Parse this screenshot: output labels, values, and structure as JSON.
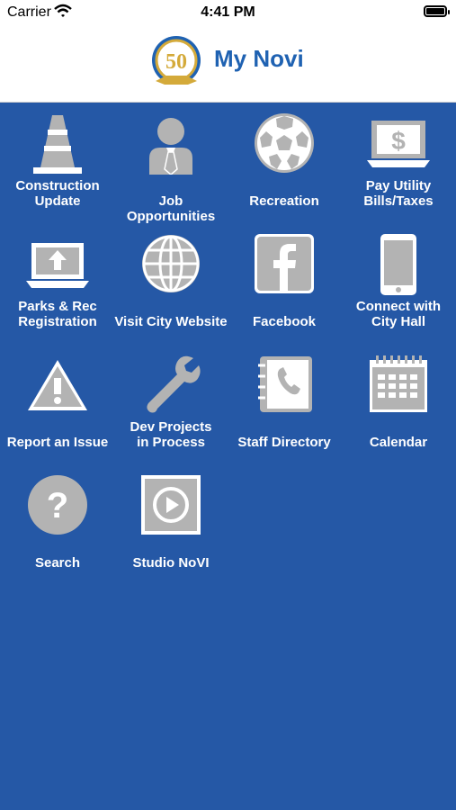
{
  "status_bar": {
    "carrier": "Carrier",
    "time": "4:41 PM",
    "battery_level": 1.0
  },
  "header": {
    "title": "My Novi",
    "logo_icon": "city-of-novi-50-logo-icon",
    "logo_number": "50"
  },
  "tiles": [
    {
      "label_line1": "Construction",
      "label_line2": "Update",
      "icon": "traffic-cone-icon"
    },
    {
      "label_line1": "Job Opportunities",
      "label_line2": "",
      "icon": "person-tie-icon"
    },
    {
      "label_line1": "Recreation",
      "label_line2": "",
      "icon": "soccer-ball-icon"
    },
    {
      "label_line1": "Pay Utility",
      "label_line2": "Bills/Taxes",
      "icon": "dollar-monitor-icon"
    },
    {
      "label_line1": "Parks & Rec",
      "label_line2": "Registration",
      "icon": "laptop-upload-icon"
    },
    {
      "label_line1": "Visit City Website",
      "label_line2": "",
      "icon": "globe-icon"
    },
    {
      "label_line1": "Facebook",
      "label_line2": "",
      "icon": "facebook-icon"
    },
    {
      "label_line1": "Connect with",
      "label_line2": "City Hall",
      "icon": "smartphone-icon"
    },
    {
      "label_line1": "Report an Issue",
      "label_line2": "",
      "icon": "warning-icon"
    },
    {
      "label_line1": "Dev Projects",
      "label_line2": "in Process",
      "icon": "wrench-icon"
    },
    {
      "label_line1": "Staff Directory",
      "label_line2": "",
      "icon": "phone-book-icon"
    },
    {
      "label_line1": "Calendar",
      "label_line2": "",
      "icon": "calendar-icon"
    },
    {
      "label_line1": "Search",
      "label_line2": "",
      "icon": "question-icon"
    },
    {
      "label_line1": "Studio NoVI",
      "label_line2": "",
      "icon": "play-icon"
    }
  ],
  "colors": {
    "background": "#2558a6",
    "icon_gray": "#b3b3b3",
    "title_blue": "#1f62b2",
    "label": "#ffffff"
  }
}
